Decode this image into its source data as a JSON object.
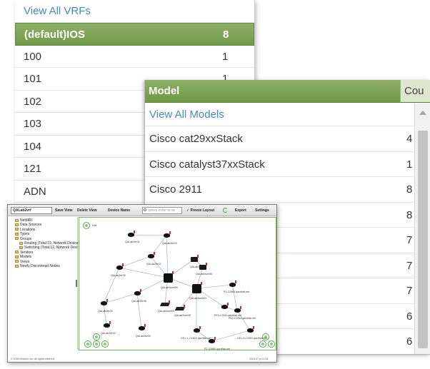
{
  "vrf_panel": {
    "view_all": "View All VRFs",
    "rows": [
      {
        "name": "(default)IOS",
        "count": "8",
        "selected": true
      },
      {
        "name": "100",
        "count": "1"
      },
      {
        "name": "101",
        "count": "1"
      },
      {
        "name": "102",
        "count": ""
      },
      {
        "name": "103",
        "count": ""
      },
      {
        "name": "104",
        "count": ""
      },
      {
        "name": "121",
        "count": ""
      },
      {
        "name": "ADN",
        "count": ""
      }
    ]
  },
  "model_panel": {
    "header_model": "Model",
    "header_count": "Cou",
    "view_all": "View All Models",
    "rows": [
      {
        "name": "Cisco cat29xxStack",
        "count": "4"
      },
      {
        "name": "Cisco catalyst37xxStack",
        "count": "1"
      },
      {
        "name": "Cisco 2911",
        "count": "8"
      },
      {
        "name": "",
        "count": "8"
      },
      {
        "name": "",
        "count": "7"
      },
      {
        "name": "",
        "count": "7"
      },
      {
        "name": "",
        "count": "7"
      },
      {
        "name": "",
        "count": "6"
      },
      {
        "name": "",
        "count": "6"
      }
    ]
  },
  "topology": {
    "toolbar": {
      "selected_view": "QALab2vrf",
      "save_view": "Save View",
      "delete_view": "Delete View",
      "device_name": "Device Name",
      "search_placeholder": "press enter to se",
      "freeze_layout": "Freeze Layout",
      "export": "Export",
      "settings": "Settings"
    },
    "tree": [
      {
        "label": "NetMRI",
        "level": 1
      },
      {
        "label": "Data Sources",
        "level": 1
      },
      {
        "label": "Locations",
        "level": 1
      },
      {
        "label": "Types",
        "level": 1
      },
      {
        "label": "Groups",
        "level": 1
      },
      {
        "label": "Routing (Total:19, Network Device",
        "level": 2
      },
      {
        "label": "Switching (Total:12, Network Devi",
        "level": 2
      },
      {
        "label": "Vendors",
        "level": 1
      },
      {
        "label": "Models",
        "level": 1
      },
      {
        "label": "Views",
        "level": 1
      },
      {
        "label": "Newly Discovered Nodes",
        "level": 1
      }
    ],
    "edit_label": "Edit",
    "nodes": [
      {
        "id": "QALab2rtr01",
        "label": "QALab2rtr01"
      },
      {
        "id": "QALab2rtr03",
        "label": "QALab2rtr03"
      },
      {
        "id": "QALab2rtr07",
        "label": "QALab2rtr07"
      },
      {
        "id": "QALab2rtr09",
        "label": "QALab2rtr09"
      },
      {
        "id": "QALab2swr01",
        "label": "QALab2swr01"
      },
      {
        "id": "QALab2swr06",
        "label": "QALab2swr06"
      },
      {
        "id": "QALab2swrt09",
        "label": "QALab2swrt09"
      },
      {
        "id": "QALab2swrt04",
        "label": "QALab2swrt04"
      },
      {
        "id": "QALab2rtr08",
        "label": "QALab2rtr08"
      },
      {
        "id": "QALab2rtr04",
        "label": "QALab2rtr04"
      },
      {
        "id": "QALab2swr03",
        "label": "QALab2swr03"
      },
      {
        "id": "QALab2swr05",
        "label": "QALab2swr05"
      },
      {
        "id": "P1-C2960",
        "label": "P1-C2960.qavrflab.net"
      },
      {
        "id": "PE3-C2911",
        "label": "PE3-C2911.qavrflab.net"
      },
      {
        "id": "PE2-C2911",
        "label": "PE2-C2911.qavrflab.net"
      },
      {
        "id": "QALab2rtr02",
        "label": "QALab2rtr02"
      },
      {
        "id": "QALab2rtr05",
        "label": "QALab2rtr05"
      },
      {
        "id": "CE1-1",
        "label": "CE1-1_C1603.qavrflab.net"
      },
      {
        "id": "CE1-2",
        "label": "CE1-2-C2901.qavrflab.net"
      },
      {
        "id": "P2-C2960",
        "label": "P2-C2960.qavrflab.net"
      }
    ],
    "footer_copyright": "© 2018 Infoblox, Inc. All rights reserved.",
    "footer_date": "2018-07-jh 14:24"
  }
}
